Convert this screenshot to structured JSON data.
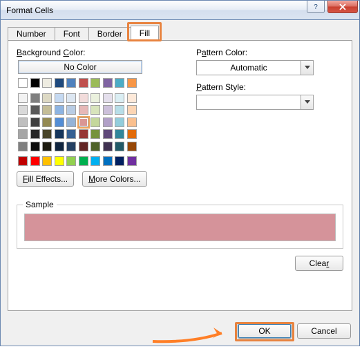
{
  "title": "Format Cells",
  "tabs": [
    "Number",
    "Font",
    "Border",
    "Fill"
  ],
  "active_tab": 3,
  "labels": {
    "background_color": "Background Color:",
    "pattern_color": "Pattern Color:",
    "pattern_style": "Pattern Style:",
    "no_color": "No Color",
    "fill_effects": "Fill Effects...",
    "more_colors": "More Colors...",
    "sample": "Sample",
    "clear": "Clear",
    "ok": "OK",
    "cancel": "Cancel"
  },
  "pattern_color_value": "Automatic",
  "pattern_style_value": "",
  "selected_color": "#d5939a",
  "palette": {
    "row0": [
      "nofill",
      "#000000",
      "#eeece1",
      "#1f497d",
      "#4f81bd",
      "#c0504d",
      "#9bbb59",
      "#8064a2",
      "#4bacc6",
      "#f79646"
    ],
    "theme": [
      [
        "#f2f2f2",
        "#7f7f7f",
        "#ddd9c4",
        "#c5d9f1",
        "#dce6f1",
        "#f2dcdb",
        "#ebf1de",
        "#e4dfec",
        "#daeef3",
        "#fde9d9"
      ],
      [
        "#d9d9d9",
        "#595959",
        "#c4bd97",
        "#8db4e2",
        "#b8cce4",
        "#e6b8b7",
        "#d8e4bc",
        "#ccc0da",
        "#b7dee8",
        "#fcd5b4"
      ],
      [
        "#bfbfbf",
        "#404040",
        "#948a53",
        "#538dd5",
        "#95b3d7",
        "#da9694",
        "#c4d79b",
        "#b1a0c7",
        "#92cddc",
        "#fac08f"
      ],
      [
        "#a6a6a6",
        "#262626",
        "#494529",
        "#16365c",
        "#366092",
        "#963634",
        "#76933c",
        "#60497a",
        "#31869b",
        "#e26b0a"
      ],
      [
        "#808080",
        "#0c0c0c",
        "#1d1b10",
        "#0f243e",
        "#244062",
        "#632523",
        "#4f6228",
        "#403151",
        "#215967",
        "#974706"
      ]
    ],
    "standard": [
      "#c00000",
      "#ff0000",
      "#ffc000",
      "#ffff00",
      "#92d050",
      "#00b050",
      "#00b0f0",
      "#0070c0",
      "#002060",
      "#7030a0"
    ]
  },
  "selected_swatch": {
    "group": "theme",
    "row": 2,
    "col": 5
  }
}
